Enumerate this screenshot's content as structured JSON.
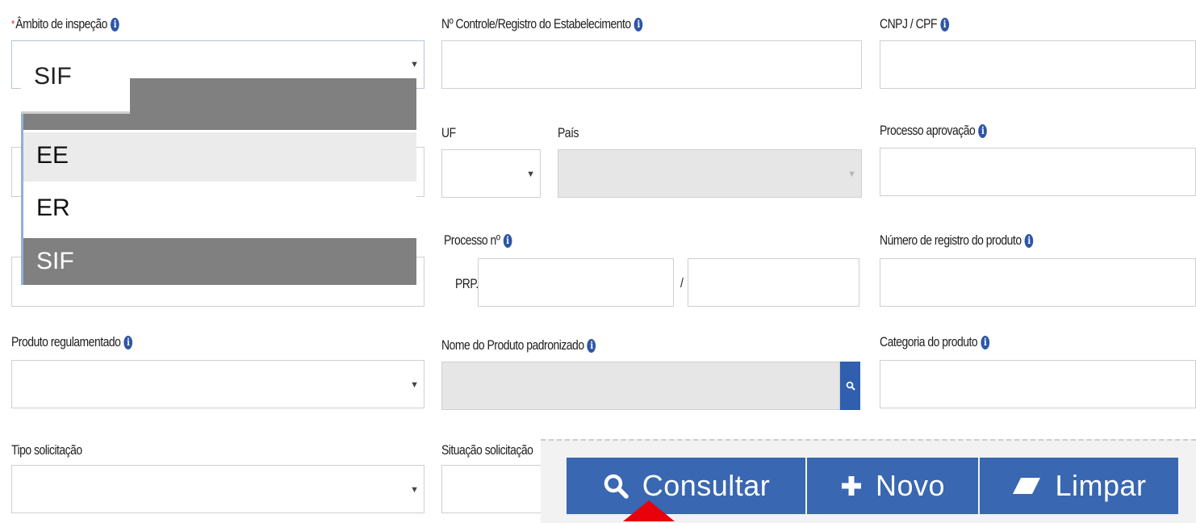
{
  "form": {
    "ambito_label": "Âmbito de inspeção",
    "ambito_required_mark": "*",
    "ambito_value": "SIF",
    "controle_label": "Nº Controle/Registro do Estabelecimento",
    "cnpj_label": "CNPJ / CPF",
    "uf_label": "UF",
    "pais_label": "País",
    "processo_aprovacao_label": "Processo aprovação",
    "processo_label": "Processo nº",
    "processo_prefix": "PRP.",
    "processo_separator": "/",
    "numero_registro_label": "Número de registro do produto",
    "produto_regulamentado_label": "Produto regulamentado",
    "nome_produto_label": "Nome do Produto padronizado",
    "categoria_label": "Categoria do produto",
    "tipo_solicitacao_label": "Tipo solicitação",
    "situacao_solicitacao_label": "Situação solicitação"
  },
  "dropdown": {
    "options": [
      "",
      "EE",
      "ER",
      "SIF"
    ],
    "highlighted": "SIF"
  },
  "actions": {
    "consultar_label": "Consultar",
    "novo_label": "Novo",
    "limpar_label": "Limpar"
  },
  "icons": {
    "info": "info-circle-icon",
    "search": "search-icon",
    "caret": "chevron-down-icon",
    "plus": "plus-icon",
    "eraser": "eraser-icon"
  },
  "colors": {
    "primary": "#3967b1",
    "info": "#2d56a6",
    "dropdown_highlight": "#808080",
    "annotation_arrow": "#e8000b"
  },
  "info_glyph": "i",
  "caret_glyph": "▼"
}
